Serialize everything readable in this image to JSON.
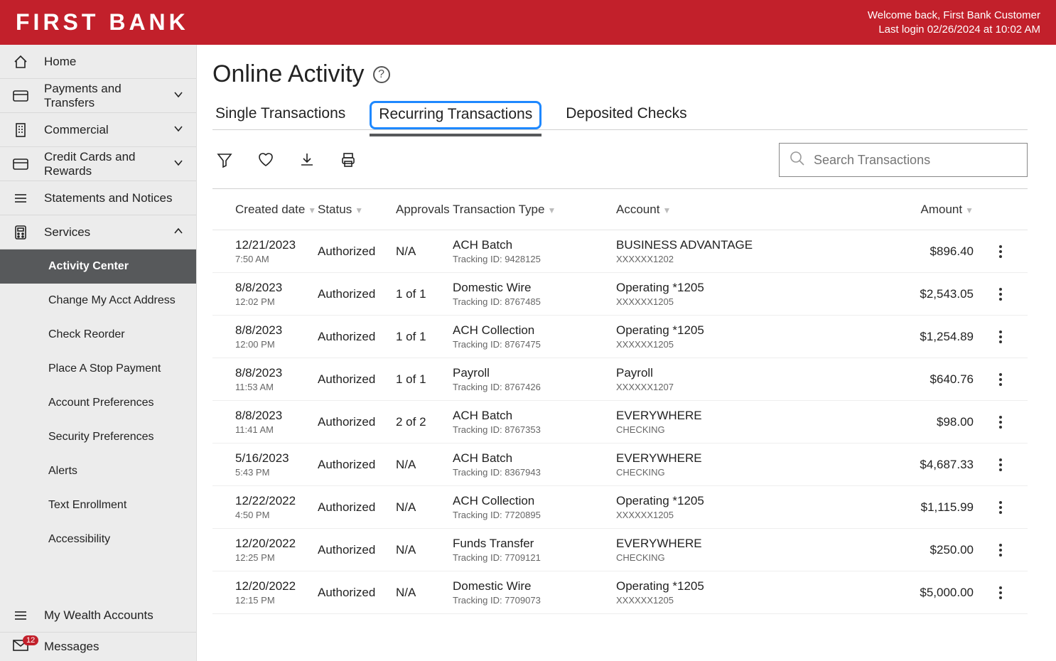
{
  "header": {
    "logo": "FIRST BANK",
    "welcome": "Welcome back, First Bank Customer",
    "last_login": "Last login 02/26/2024 at 10:02 AM"
  },
  "sidebar": {
    "items": [
      {
        "label": "Home",
        "icon": "home"
      },
      {
        "label": "Payments and Transfers",
        "icon": "card",
        "chev": "down"
      },
      {
        "label": "Commercial",
        "icon": "building",
        "chev": "down"
      },
      {
        "label": "Credit Cards and Rewards",
        "icon": "card",
        "chev": "down"
      },
      {
        "label": "Statements and Notices",
        "icon": "lines"
      },
      {
        "label": "Services",
        "icon": "calc",
        "chev": "up"
      }
    ],
    "services_sub": [
      "Activity Center",
      "Change My Acct Address",
      "Check Reorder",
      "Place A Stop Payment",
      "Account Preferences",
      "Security Preferences",
      "Alerts",
      "Text Enrollment",
      "Accessibility"
    ],
    "wealth": "My Wealth Accounts",
    "messages": "Messages",
    "messages_badge": "12"
  },
  "page": {
    "title": "Online Activity",
    "tabs": [
      "Single Transactions",
      "Recurring Transactions",
      "Deposited Checks"
    ],
    "active_tab": 1,
    "search_placeholder": "Search Transactions",
    "columns": [
      "Created date",
      "Status",
      "Approvals",
      "Transaction Type",
      "Account",
      "Amount"
    ]
  },
  "transactions": [
    {
      "date": "12/21/2023",
      "time": "7:50 AM",
      "status": "Authorized",
      "approvals": "N/A",
      "type": "ACH Batch",
      "tracking": "Tracking ID: 9428125",
      "account": "BUSINESS ADVANTAGE",
      "acct_sub": "XXXXXX1202",
      "amount": "$896.40"
    },
    {
      "date": "8/8/2023",
      "time": "12:02 PM",
      "status": "Authorized",
      "approvals": "1 of 1",
      "type": "Domestic Wire",
      "tracking": "Tracking ID: 8767485",
      "account": "Operating *1205",
      "acct_sub": "XXXXXX1205",
      "amount": "$2,543.05"
    },
    {
      "date": "8/8/2023",
      "time": "12:00 PM",
      "status": "Authorized",
      "approvals": "1 of 1",
      "type": "ACH Collection",
      "tracking": "Tracking ID: 8767475",
      "account": "Operating *1205",
      "acct_sub": "XXXXXX1205",
      "amount": "$1,254.89"
    },
    {
      "date": "8/8/2023",
      "time": "11:53 AM",
      "status": "Authorized",
      "approvals": "1 of 1",
      "type": "Payroll",
      "tracking": "Tracking ID: 8767426",
      "account": "Payroll",
      "acct_sub": "XXXXXX1207",
      "amount": "$640.76"
    },
    {
      "date": "8/8/2023",
      "time": "11:41 AM",
      "status": "Authorized",
      "approvals": "2 of 2",
      "type": "ACH Batch",
      "tracking": "Tracking ID: 8767353",
      "account": "EVERYWHERE",
      "acct_sub": "CHECKING",
      "amount": "$98.00"
    },
    {
      "date": "5/16/2023",
      "time": "5:43 PM",
      "status": "Authorized",
      "approvals": "N/A",
      "type": "ACH Batch",
      "tracking": "Tracking ID: 8367943",
      "account": "EVERYWHERE",
      "acct_sub": "CHECKING",
      "amount": "$4,687.33"
    },
    {
      "date": "12/22/2022",
      "time": "4:50 PM",
      "status": "Authorized",
      "approvals": "N/A",
      "type": "ACH Collection",
      "tracking": "Tracking ID: 7720895",
      "account": "Operating *1205",
      "acct_sub": "XXXXXX1205",
      "amount": "$1,115.99"
    },
    {
      "date": "12/20/2022",
      "time": "12:25 PM",
      "status": "Authorized",
      "approvals": "N/A",
      "type": "Funds Transfer",
      "tracking": "Tracking ID: 7709121",
      "account": "EVERYWHERE",
      "acct_sub": "CHECKING",
      "amount": "$250.00"
    },
    {
      "date": "12/20/2022",
      "time": "12:15 PM",
      "status": "Authorized",
      "approvals": "N/A",
      "type": "Domestic Wire",
      "tracking": "Tracking ID: 7709073",
      "account": "Operating *1205",
      "acct_sub": "XXXXXX1205",
      "amount": "$5,000.00"
    }
  ]
}
